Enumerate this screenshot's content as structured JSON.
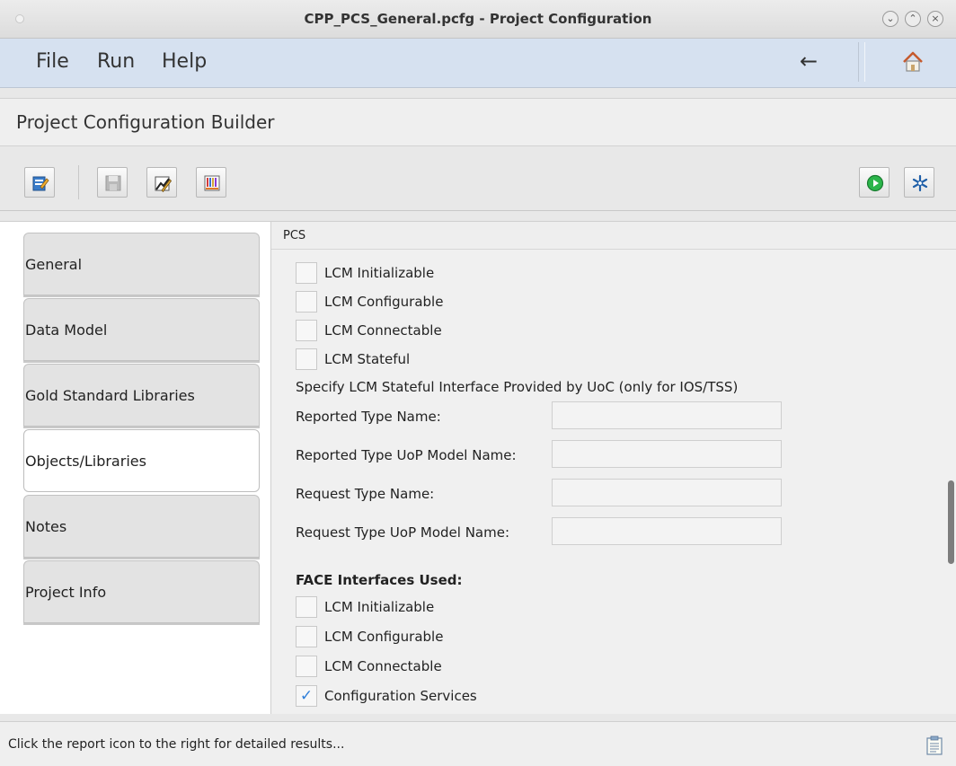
{
  "window": {
    "title": "CPP_PCS_General.pcfg - Project Configuration",
    "controls": {
      "minimize": "⌄",
      "maximize": "⌃",
      "close": "×"
    }
  },
  "menu": {
    "items": [
      "File",
      "Run",
      "Help"
    ],
    "back_icon": "left-arrow-icon",
    "home_icon": "home-icon"
  },
  "builder": {
    "title": "Project Configuration Builder"
  },
  "toolbar": {
    "left_icons": [
      "clipboard-edit-icon",
      "save-disk-icon",
      "chart-edit-icon",
      "barcode-chart-icon"
    ],
    "right_icons": [
      "play-circle-icon",
      "snowflake-icon"
    ]
  },
  "tabs": [
    {
      "label": "General",
      "active": false
    },
    {
      "label": "Data Model",
      "active": false
    },
    {
      "label": "Gold Standard Libraries",
      "active": false
    },
    {
      "label": "Objects/Libraries",
      "active": true
    },
    {
      "label": "Notes",
      "active": false
    },
    {
      "label": "Project Info",
      "active": false
    }
  ],
  "panel": {
    "header": "PCS",
    "top_checkboxes": [
      {
        "label": "LCM Initializable",
        "checked": false
      },
      {
        "label": "LCM Configurable",
        "checked": false
      },
      {
        "label": "LCM Connectable",
        "checked": false
      },
      {
        "label": "LCM Stateful",
        "checked": false
      }
    ],
    "stateful_heading": "Specify LCM Stateful Interface Provided by UoC (only for IOS/TSS)",
    "fields": [
      {
        "label": "Reported Type Name:",
        "value": ""
      },
      {
        "label": "Reported Type UoP Model Name:",
        "value": ""
      },
      {
        "label": "Request Type Name:",
        "value": ""
      },
      {
        "label": "Request Type UoP Model Name:",
        "value": ""
      }
    ],
    "face_heading": "FACE Interfaces Used:",
    "face_checkboxes": [
      {
        "label": "LCM Initializable",
        "checked": false
      },
      {
        "label": "LCM Configurable",
        "checked": false
      },
      {
        "label": "LCM Connectable",
        "checked": false
      },
      {
        "label": "Configuration Services",
        "checked": true
      }
    ],
    "check_mark": "✓"
  },
  "status": {
    "text": "Click the report icon to the right for detailed results...",
    "icon": "report-clipboard-icon"
  },
  "colors": {
    "menubar": "#d6e1f0",
    "play_green": "#2bb54a",
    "check_blue": "#2f7fd9"
  }
}
